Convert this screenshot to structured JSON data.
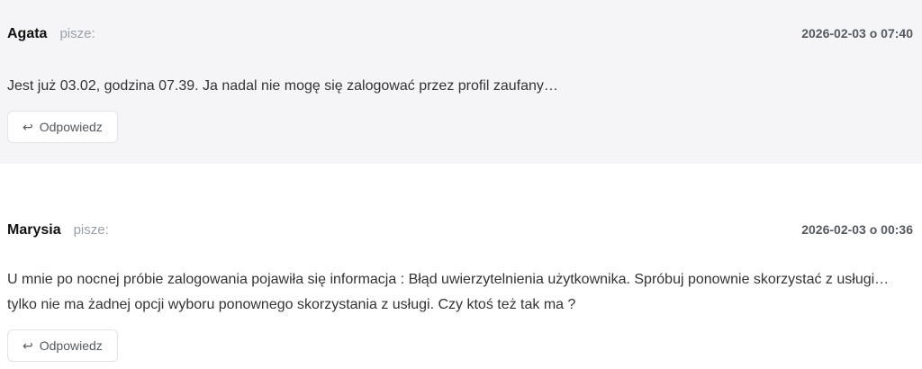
{
  "comments": [
    {
      "author": "Agata",
      "writes_label": "pisze:",
      "date": "2026-02-03 o 07:40",
      "text": "Jest już 03.02, godzina 07.39. Ja nadal nie mogę się zalogować przez profil zaufany…",
      "reply_label": "Odpowiedz",
      "reply_icon": "reply-arrow-icon"
    },
    {
      "author": "Marysia",
      "writes_label": "pisze:",
      "date": "2026-02-03 o 00:36",
      "text": "U mnie po nocnej próbie zalogowania pojawiła się informacja : Błąd uwierzytelnienia użytkownika. Spróbuj ponownie skorzystać z usługi… tylko nie ma żadnej opcji wyboru ponownego skorzystania z usługi. Czy ktoś też tak ma ?",
      "reply_label": "Odpowiedz",
      "reply_icon": "reply-arrow-icon"
    }
  ],
  "colors": {
    "shaded_background": "#f5f5f7",
    "author_text": "#111111",
    "muted_text": "#9aa0a8"
  }
}
